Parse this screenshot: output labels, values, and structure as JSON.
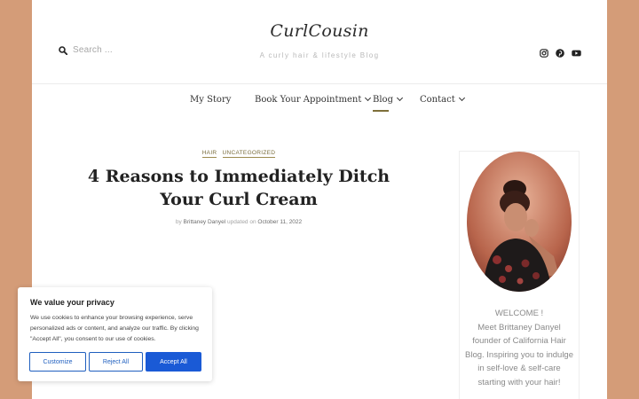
{
  "header": {
    "search_placeholder": "Search ...",
    "logo": "CurlCousin",
    "tagline": "A curly hair & lifestyle Blog",
    "social": [
      "instagram-icon",
      "pinterest-icon",
      "youtube-icon"
    ]
  },
  "nav": {
    "items": [
      {
        "label": "My Story",
        "dropdown": false
      },
      {
        "label": "Book Your Appointment",
        "dropdown": true
      },
      {
        "label": "Blog",
        "dropdown": true,
        "active": true
      },
      {
        "label": "Contact",
        "dropdown": true
      }
    ]
  },
  "article": {
    "categories": [
      "HAIR",
      "UNCATEGORIZED"
    ],
    "title": "4 Reasons to Immediately Ditch Your Curl Cream",
    "byline": {
      "prefix": "by",
      "author": "Brittaney Danyel",
      "updated_prefix": "updated on",
      "date": "October 11, 2022"
    }
  },
  "sidebar": {
    "welcome_lines": [
      "WELCOME !",
      "Meet Brittaney Danyel",
      "founder of California Hair",
      "Blog. Inspiring you to indulge",
      "in self-love & self-care",
      "starting with your hair!"
    ]
  },
  "cookie": {
    "title": "We value your privacy",
    "text": "We use cookies to enhance your browsing experience, serve personalized ads or content, and analyze our traffic. By clicking \"Accept All\", you consent to our use of cookies.",
    "customize": "Customize",
    "reject": "Reject All",
    "accept": "Accept All"
  },
  "colors": {
    "background": "#d49c78",
    "accent": "#7e6f3a",
    "button_blue": "#1a5ad6"
  }
}
